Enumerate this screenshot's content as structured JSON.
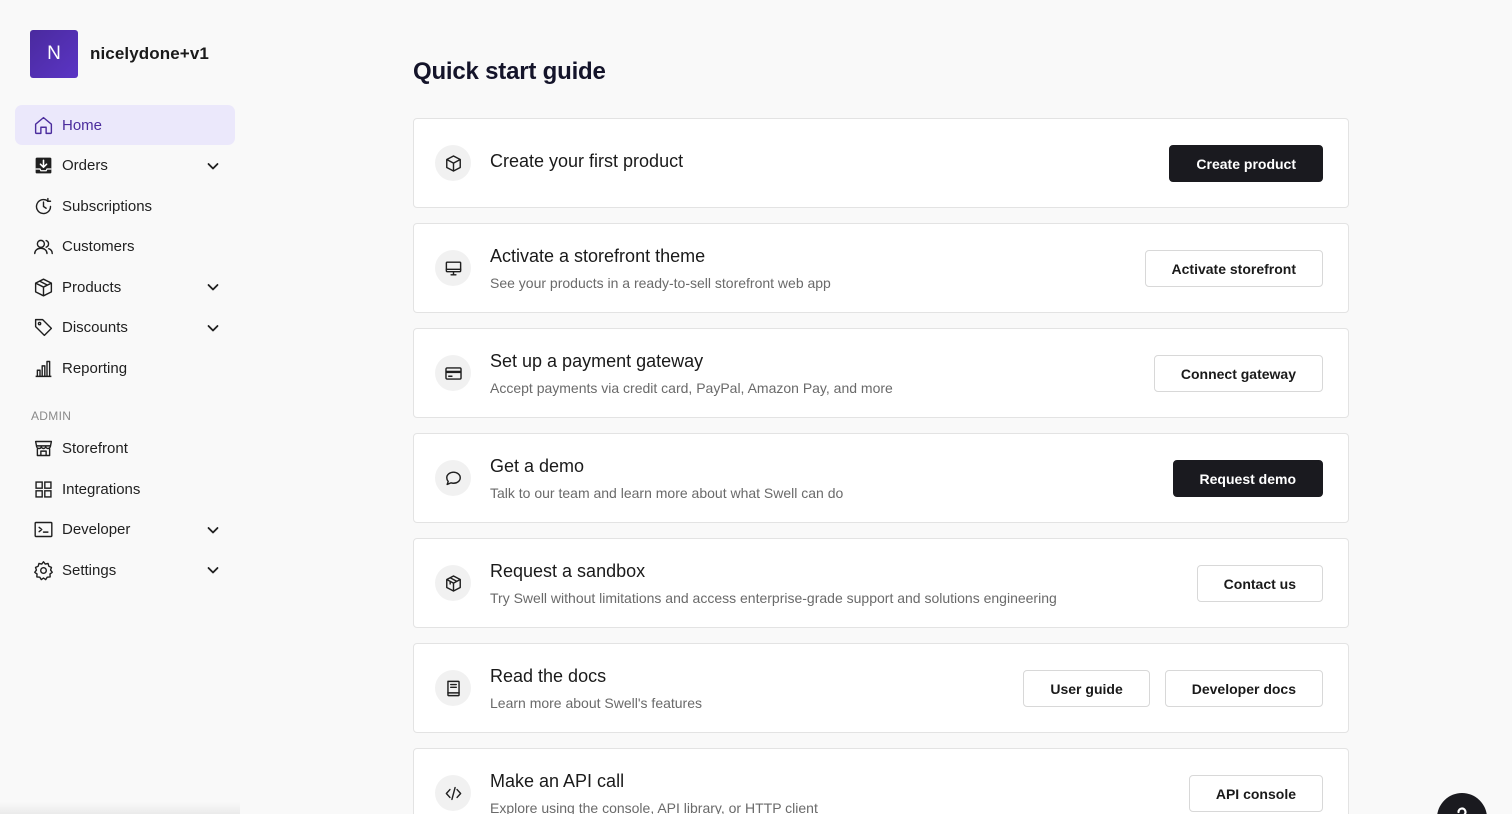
{
  "store": {
    "avatar_letter": "N",
    "name": "nicelydone+v1"
  },
  "colors": {
    "accent": "#4b2c9d",
    "accent_bg": "#ebe8fb",
    "primary_button": "#1a1a1f"
  },
  "nav": {
    "items": [
      {
        "label": "Home",
        "icon": "home-icon",
        "active": true,
        "expandable": false
      },
      {
        "label": "Orders",
        "icon": "orders-icon",
        "active": false,
        "expandable": true
      },
      {
        "label": "Subscriptions",
        "icon": "subscriptions-icon",
        "active": false,
        "expandable": false
      },
      {
        "label": "Customers",
        "icon": "customers-icon",
        "active": false,
        "expandable": false
      },
      {
        "label": "Products",
        "icon": "products-icon",
        "active": false,
        "expandable": true
      },
      {
        "label": "Discounts",
        "icon": "tag-icon",
        "active": false,
        "expandable": true
      },
      {
        "label": "Reporting",
        "icon": "bar-chart-icon",
        "active": false,
        "expandable": false
      }
    ],
    "admin_title": "ADMIN",
    "admin_items": [
      {
        "label": "Storefront",
        "icon": "storefront-icon",
        "expandable": false
      },
      {
        "label": "Integrations",
        "icon": "grid-icon",
        "expandable": false
      },
      {
        "label": "Developer",
        "icon": "terminal-icon",
        "expandable": true
      },
      {
        "label": "Settings",
        "icon": "gear-icon",
        "expandable": true
      }
    ]
  },
  "main": {
    "title": "Quick start guide",
    "cards": [
      {
        "title": "Create your first product",
        "desc": "",
        "icon": "box-icon",
        "actions": [
          {
            "label": "Create product",
            "style": "primary"
          }
        ]
      },
      {
        "title": "Activate a storefront theme",
        "desc": "See your products in a ready-to-sell storefront web app",
        "icon": "monitor-icon",
        "actions": [
          {
            "label": "Activate storefront",
            "style": "secondary"
          }
        ]
      },
      {
        "title": "Set up a payment gateway",
        "desc": "Accept payments via credit card, PayPal, Amazon Pay, and more",
        "icon": "credit-card-icon",
        "actions": [
          {
            "label": "Connect gateway",
            "style": "secondary"
          }
        ]
      },
      {
        "title": "Get a demo",
        "desc": "Talk to our team and learn more about what Swell can do",
        "icon": "chat-bubble-icon",
        "actions": [
          {
            "label": "Request demo",
            "style": "primary"
          }
        ]
      },
      {
        "title": "Request a sandbox",
        "desc": "Try Swell without limitations and access enterprise-grade support and solutions engineering",
        "icon": "sandbox-box-icon",
        "actions": [
          {
            "label": "Contact us",
            "style": "secondary"
          }
        ]
      },
      {
        "title": "Read the docs",
        "desc": "Learn more about Swell's features",
        "icon": "book-icon",
        "actions": [
          {
            "label": "User guide",
            "style": "secondary"
          },
          {
            "label": "Developer docs",
            "style": "secondary"
          }
        ]
      },
      {
        "title": "Make an API call",
        "desc": "Explore using the console, API library, or HTTP client",
        "icon": "code-icon",
        "actions": [
          {
            "label": "API console",
            "style": "secondary"
          }
        ]
      }
    ]
  }
}
